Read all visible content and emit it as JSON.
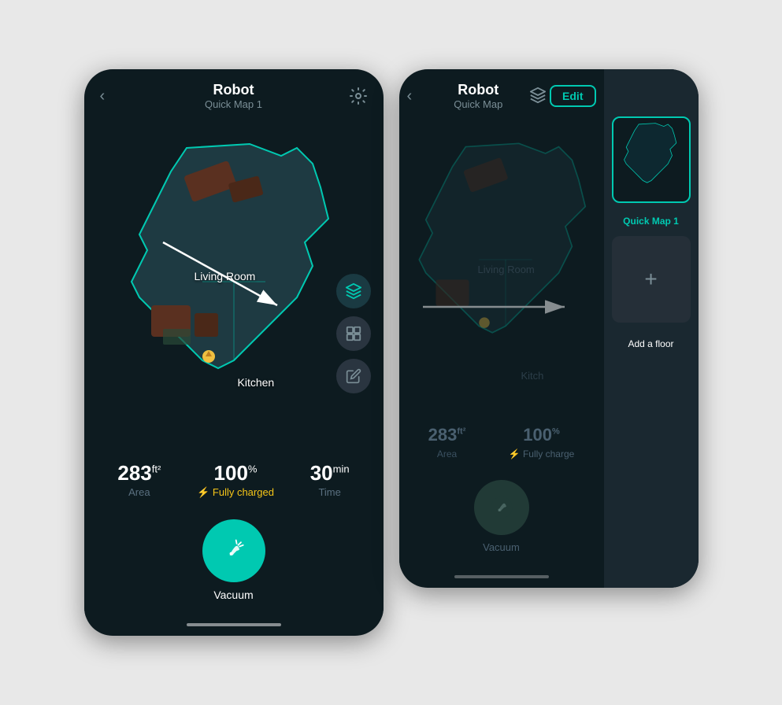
{
  "left_screen": {
    "header": {
      "back_label": "‹",
      "title": "Robot",
      "subtitle": "Quick Map 1",
      "settings_label": "⚙"
    },
    "map": {
      "room_labels": [
        {
          "id": "living_room",
          "text": "Living Room"
        },
        {
          "id": "kitchen",
          "text": "Kitchen"
        }
      ]
    },
    "buttons": {
      "layers_title": "Layers",
      "segment_title": "Segment",
      "edit_title": "Edit"
    },
    "stats": {
      "area_value": "283",
      "area_unit": "ft²",
      "area_label": "Area",
      "charge_value": "100",
      "charge_unit": "%",
      "charge_status": "⚡ Fully charged",
      "time_value": "30",
      "time_unit": "min",
      "time_label": "Time"
    },
    "vacuum": {
      "label": "Vacuum",
      "icon": "🧹"
    },
    "home_indicator": true
  },
  "right_screen": {
    "header": {
      "back_label": "‹",
      "title": "Robot",
      "subtitle": "Quick Map",
      "layers_label": "≡",
      "edit_label": "Edit"
    },
    "panel": {
      "map_card_label": "Quick Map 1",
      "add_floor_label": "Add a floor",
      "add_floor_plus": "+"
    },
    "stats": {
      "area_value": "283",
      "area_unit": "ft²",
      "area_label": "Area",
      "charge_status": "⚡ Fully charge",
      "time_value": "100",
      "time_unit": "%"
    },
    "vacuum": {
      "label": "Vacuum",
      "icon": "🧹"
    }
  },
  "colors": {
    "teal": "#00c9b1",
    "bg_dark": "#0d1b20",
    "text_white": "#ffffff",
    "text_muted": "#7a8e96",
    "yellow": "#f5c518"
  }
}
